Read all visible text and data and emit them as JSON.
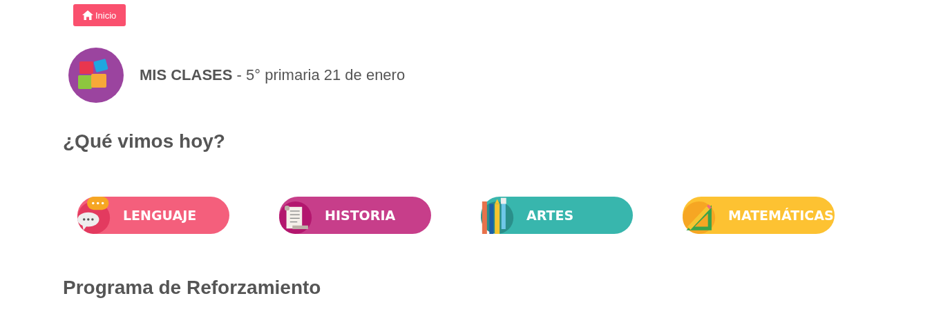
{
  "home_button": {
    "label": "Inicio"
  },
  "header": {
    "title": "**MIS CLASES** - 5° primaria 21 de enero"
  },
  "sections": [
    {
      "heading": "¿Qué vimos hoy?"
    },
    {
      "heading": "Programa de Reforzamiento"
    }
  ],
  "subjects": [
    {
      "label": "LENGUAJE",
      "kind": "chat",
      "color": "#f45f7c"
    },
    {
      "label": "HISTORIA",
      "kind": "scroll",
      "color": "#c73e8a"
    },
    {
      "label": "ARTES",
      "kind": "pencils",
      "color": "#38b6ad"
    },
    {
      "label": "MATEMÁTICAS",
      "kind": "ruler",
      "color": "#fdc232"
    }
  ]
}
